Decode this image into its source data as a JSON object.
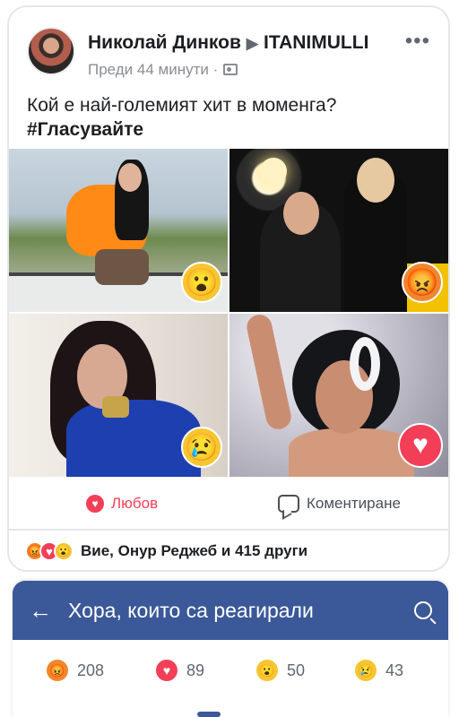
{
  "post": {
    "author": "Николай Динков",
    "target": "ITANIMULLI",
    "time": "Преди 44 минути ·",
    "text": "Кой е най-големият хит в моменга?",
    "hashtag": "#Гласувайте"
  },
  "tiles": [
    {
      "reaction": "😮"
    },
    {
      "reaction": "😡"
    },
    {
      "reaction": "😢"
    },
    {
      "reaction": "♥"
    }
  ],
  "actions": {
    "love_label": "Любов",
    "comment_label": "Коментиране"
  },
  "reactions_summary": {
    "text": "Вие, Онур Реджеб и 415 други",
    "icons": [
      "😡",
      "♥",
      "😮"
    ]
  },
  "sheet": {
    "back_icon": "←",
    "title": "Хора, които са реагирали",
    "counts": [
      {
        "icon": "😡",
        "value": "208"
      },
      {
        "icon": "♥",
        "value": "89"
      },
      {
        "icon": "😮",
        "value": "50"
      },
      {
        "icon": "😢",
        "value": "43"
      }
    ]
  },
  "colors": {
    "facebook_blue": "#3b5998",
    "love_red": "#f33e58",
    "angry_orange": "#f0872f",
    "emoji_yellow": "#f7c531"
  }
}
